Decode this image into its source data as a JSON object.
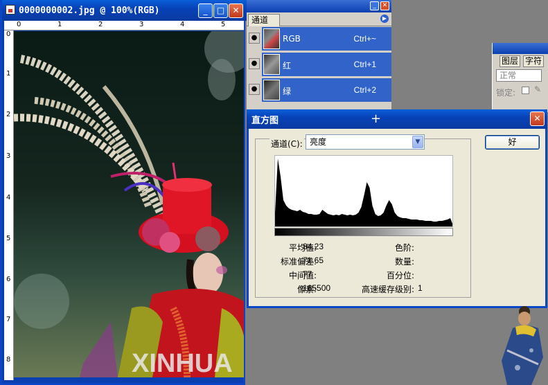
{
  "document": {
    "title": "0000000002.jpg @ 100%(RGB)",
    "ruler_h_numbers": [
      "0",
      "1",
      "2",
      "3",
      "4",
      "5"
    ],
    "ruler_v_numbers": [
      "0",
      "1",
      "2",
      "3",
      "4",
      "5",
      "6",
      "7",
      "8"
    ],
    "watermark": "XINHUA"
  },
  "channels_panel": {
    "tab": "通道",
    "channels": [
      {
        "name": "RGB",
        "shortcut": "Ctrl+~"
      },
      {
        "name": "红",
        "shortcut": "Ctrl+1"
      },
      {
        "name": "绿",
        "shortcut": "Ctrl+2"
      }
    ]
  },
  "layers_panel": {
    "tabs": [
      "图层",
      "字符"
    ],
    "blend_mode": "正常",
    "lock_label": "锁定:"
  },
  "histogram_dialog": {
    "title": "直方图",
    "channel_label": "通道(C):",
    "channel_value": "亮度",
    "ok_label": "好",
    "stats_left": [
      {
        "label": "平均值:",
        "value": "84.23"
      },
      {
        "label": "标准偏差:",
        "value": "71.65"
      },
      {
        "label": "中间值:",
        "value": "77"
      },
      {
        "label": "像素:",
        "value": "165500"
      }
    ],
    "stats_right": [
      {
        "label": "色阶:",
        "value": ""
      },
      {
        "label": "数量:",
        "value": ""
      },
      {
        "label": "百分位:",
        "value": ""
      },
      {
        "label": "高速缓存级别:",
        "value": "1"
      }
    ]
  },
  "chart_data": {
    "type": "area",
    "x": [
      0,
      4,
      8,
      12,
      16,
      20,
      24,
      28,
      32,
      36,
      40,
      44,
      48,
      52,
      56,
      60,
      64,
      68,
      72,
      76,
      80,
      84,
      88,
      92,
      96,
      100,
      104,
      108,
      112,
      116,
      120,
      124,
      128,
      132,
      136,
      140,
      144,
      148,
      152,
      156,
      160,
      164,
      168,
      172,
      176,
      180,
      184,
      188,
      192,
      196,
      200,
      204,
      208,
      212,
      216,
      220,
      224,
      228,
      232,
      236,
      240,
      244,
      248,
      252,
      255
    ],
    "values": [
      20,
      98,
      72,
      38,
      30,
      26,
      24,
      23,
      22,
      24,
      21,
      20,
      18,
      18,
      17,
      17,
      18,
      24,
      21,
      18,
      17,
      16,
      17,
      16,
      18,
      17,
      16,
      17,
      16,
      17,
      20,
      28,
      45,
      64,
      56,
      30,
      18,
      15,
      16,
      20,
      30,
      38,
      32,
      20,
      15,
      13,
      12,
      12,
      11,
      10,
      10,
      10,
      9,
      9,
      8,
      8,
      8,
      7,
      7,
      8,
      8,
      9,
      10,
      12,
      4
    ],
    "xlim": [
      0,
      255
    ]
  }
}
